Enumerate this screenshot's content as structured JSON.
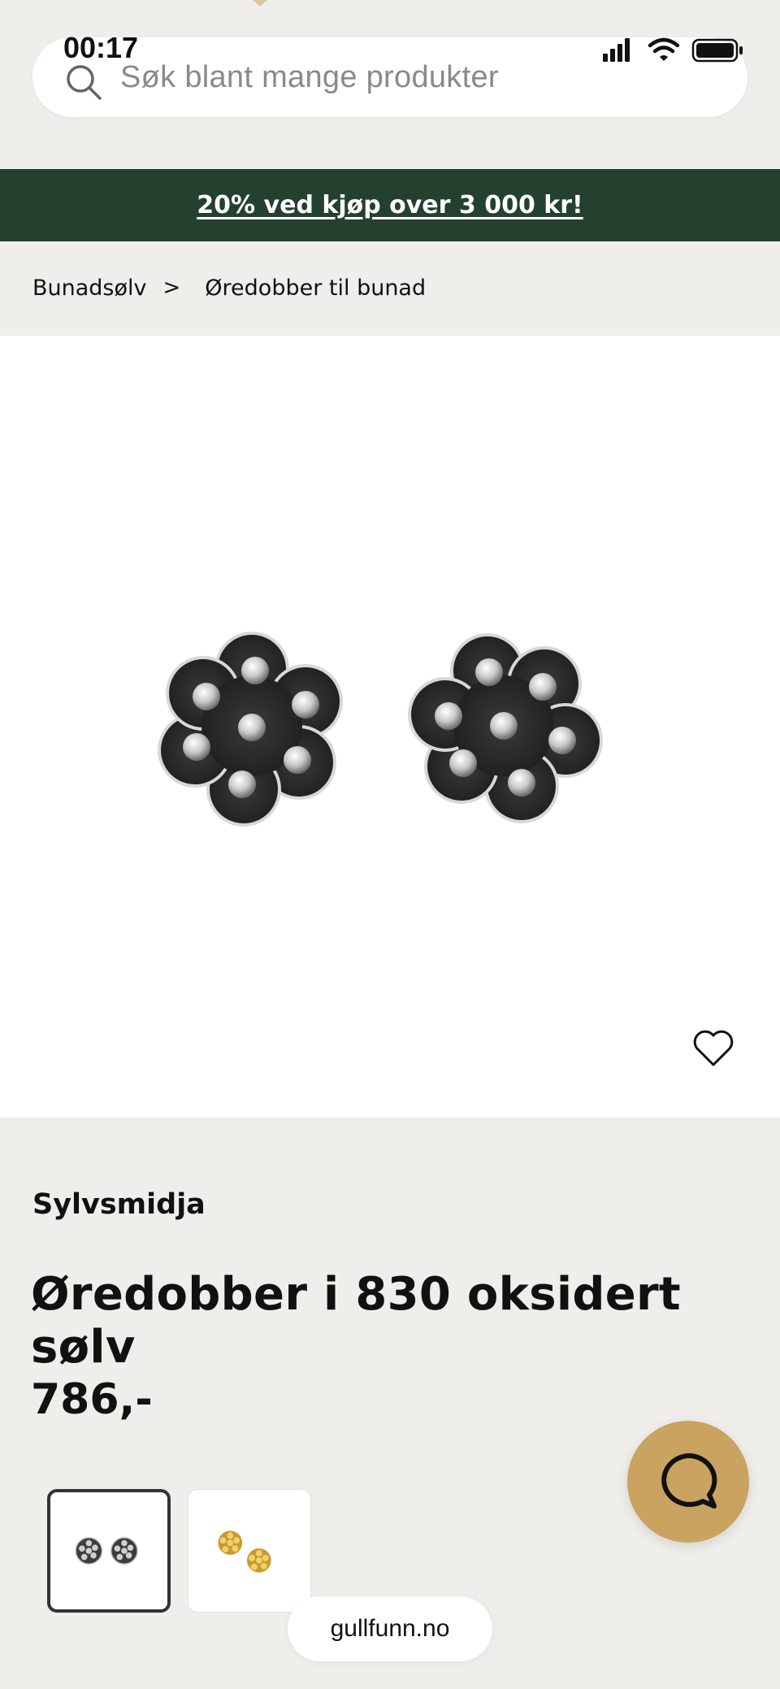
{
  "status_bar": {
    "time": "00:17",
    "icons": [
      "signal-icon",
      "wifi-icon",
      "battery-icon"
    ]
  },
  "search": {
    "placeholder": "Søk blant mange produkter",
    "icon": "search-icon"
  },
  "promo": {
    "text": "20% ved kjøp over 3 000 kr!",
    "background": "#24402f"
  },
  "breadcrumb": {
    "items": [
      "Bunadsølv",
      "Øredobber til bunad"
    ],
    "separator": ">"
  },
  "product": {
    "brand": "Sylvsmidja",
    "title": "Øredobber i 830 oksidert sølv",
    "price": "786,-",
    "favorite_icon": "heart-icon",
    "variants": [
      {
        "name": "oksidert-solv",
        "selected": true,
        "color": "#555555"
      },
      {
        "name": "forgylt",
        "selected": false,
        "color": "#d9a93a"
      }
    ]
  },
  "chat": {
    "icon": "chat-bubble-icon",
    "color": "#c9a35f"
  },
  "footer": {
    "domain": "gullfunn.no"
  }
}
